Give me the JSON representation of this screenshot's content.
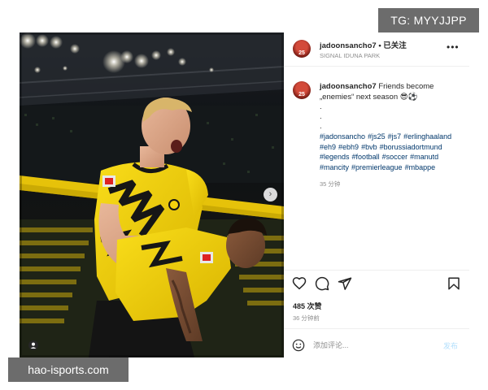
{
  "watermarks": {
    "top_right": "TG: MYYJJPP",
    "bottom_left": "hao-isports.com"
  },
  "post": {
    "photo_icons": {
      "next": "chevron-right-icon",
      "tagged_users": "user-icon"
    },
    "header": {
      "avatar_label": "25",
      "username": "jadoonsancho7",
      "separator": " • ",
      "follow_status": "已关注",
      "location": "SIGNAL IDUNA PARK",
      "more_icon": "more-horizontal-icon"
    },
    "caption": {
      "avatar_label": "25",
      "username": "jadoonsancho7",
      "text_line1": " Friends become",
      "text_line2": "„enemies“ next season 😎⚽",
      "dot1": ".",
      "dot2": ".",
      "dot3": ".",
      "hashtags": [
        "#jadonsancho",
        "#js25",
        "#js7",
        "#erlinghaaland",
        "#eh9",
        "#ebh9",
        "#bvb",
        "#borussiadortmund",
        "#legends",
        "#football",
        "#soccer",
        "#manutd",
        "#mancity",
        "#premierleague",
        "#mbappe"
      ],
      "time": "35 分钟"
    },
    "actions": {
      "like_icon": "heart-icon",
      "comment_icon": "comment-icon",
      "share_icon": "send-icon",
      "save_icon": "bookmark-icon"
    },
    "likes": "485 次赞",
    "posted": "36 分钟前",
    "comment": {
      "emoji_icon": "emoji-icon",
      "placeholder": "添加评论...",
      "value": "",
      "post_label": "发布"
    }
  },
  "colors": {
    "bvb_yellow": "#f5d20d",
    "link_blue": "#00376b",
    "muted_gray": "#8e8e8e",
    "post_button_disabled": "#b2dffc"
  }
}
